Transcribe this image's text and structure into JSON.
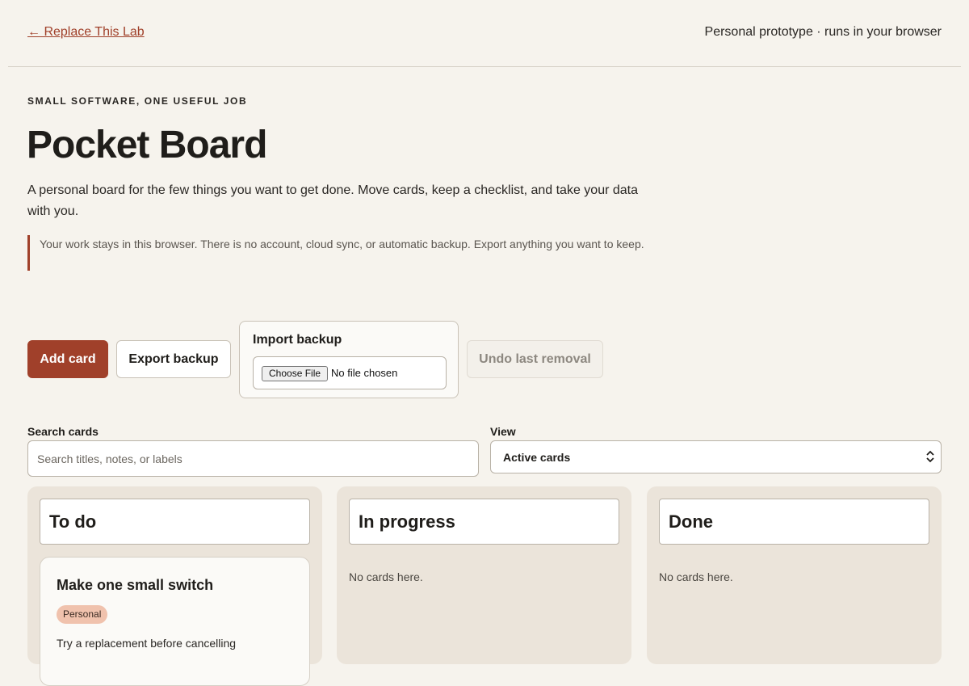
{
  "topbar": {
    "back_link": "← Replace This Lab",
    "note": "Personal prototype · runs in your browser"
  },
  "hero": {
    "eyebrow": "SMALL SOFTWARE, ONE USEFUL JOB",
    "title": "Pocket Board",
    "intro": "A personal board for the few things you want to get done. Move cards, keep a checklist, and take your data with you.",
    "notice": "Your work stays in this browser. There is no account, cloud sync, or automatic backup. Export anything you want to keep."
  },
  "toolbar": {
    "add_label": "Add card",
    "export_label": "Export backup",
    "import_label": "Import backup",
    "file_button": "Choose File",
    "file_status": "No file chosen",
    "undo_label": "Undo last removal"
  },
  "filters": {
    "search_label": "Search cards",
    "search_placeholder": "Search titles, notes, or labels",
    "search_value": "",
    "view_label": "View",
    "view_value": "Active cards"
  },
  "columns": [
    {
      "title": "To do",
      "cards": [
        {
          "title": "Make one small switch",
          "tag": "Personal",
          "note": "Try a replacement before cancelling"
        }
      ]
    },
    {
      "title": "In progress",
      "empty": "No cards here."
    },
    {
      "title": "Done",
      "empty": "No cards here."
    }
  ],
  "colors": {
    "accent": "#a0402a",
    "background": "#f6f3ed",
    "column": "#ebe4da",
    "tag": "#f0c2ad"
  }
}
